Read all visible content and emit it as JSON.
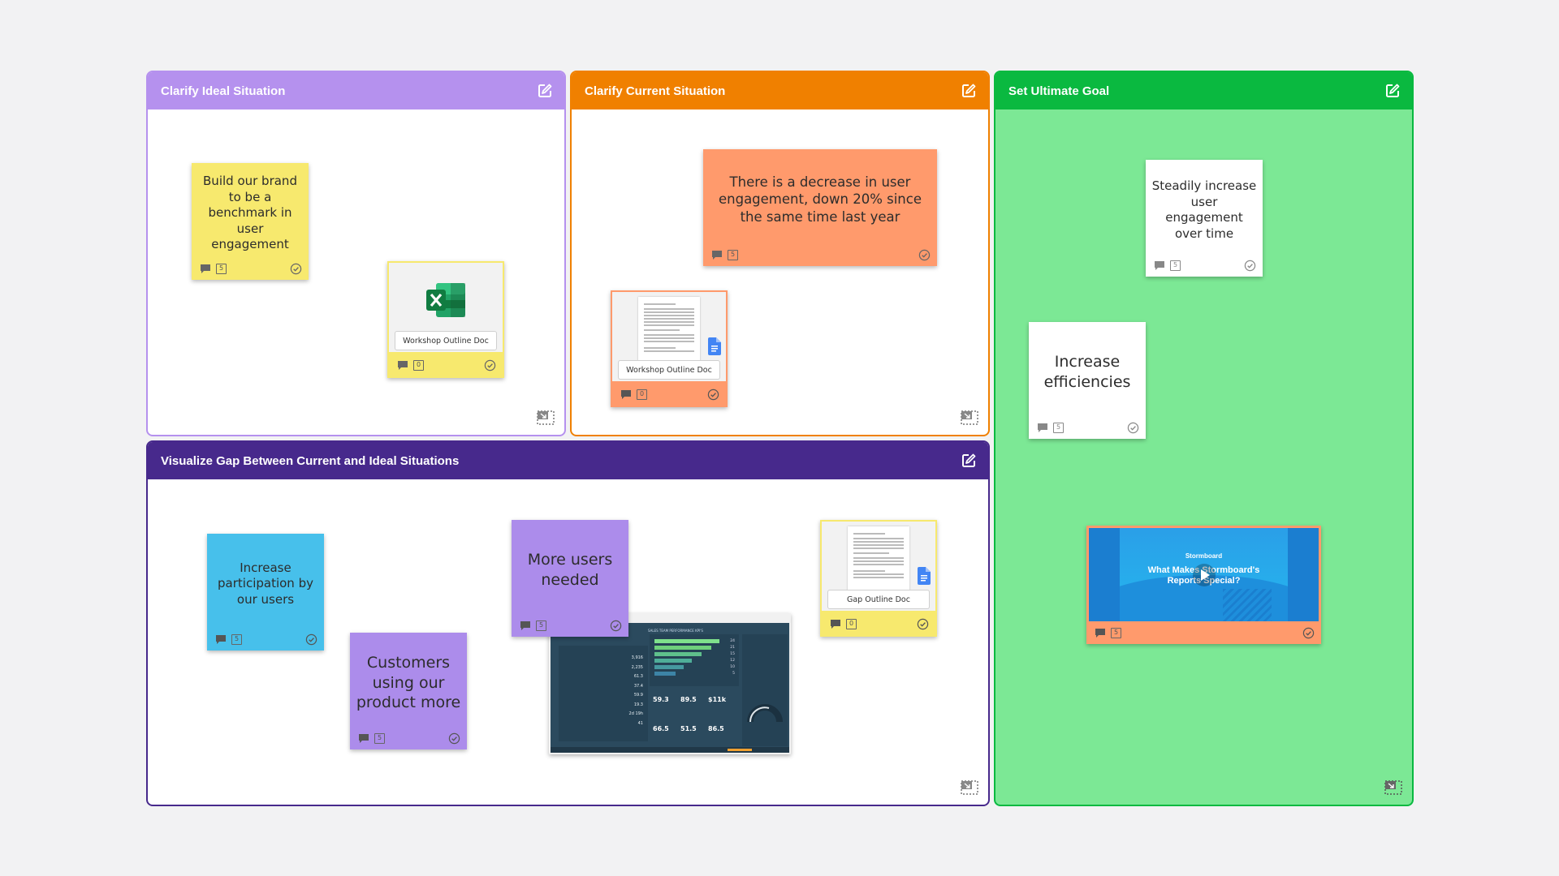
{
  "colors": {
    "ideal": "#b591ee",
    "current": "#f08000",
    "goal": "#0ab940",
    "goal_fill": "#7ce895",
    "gap": "#47298c",
    "note_yellow": "#f7e96e",
    "note_orange": "#ff9a6c",
    "note_blue": "#47c0eb",
    "note_purple": "#ac8ceb",
    "note_white": "#ffffff"
  },
  "sections": {
    "ideal": {
      "title": "Clarify Ideal Situation"
    },
    "current": {
      "title": "Clarify Current Situation"
    },
    "goal": {
      "title": "Set Ultimate Goal"
    },
    "gap": {
      "title": "Visualize Gap Between Current and Ideal Situations"
    }
  },
  "notes": {
    "brand": {
      "text": "Build our brand to be a benchmark in user engagement",
      "votes": "5"
    },
    "decrease": {
      "text": "There is a decrease in user engagement, down 20% since the same time last year",
      "votes": "5"
    },
    "steady": {
      "text": "Steadily increase user engagement over time",
      "votes": "5"
    },
    "efficiencies": {
      "text": "Increase efficiencies",
      "votes": "5"
    },
    "participation": {
      "text": "Increase participation by our users",
      "votes": "5"
    },
    "customers": {
      "text": "Customers using our product more",
      "votes": "5"
    },
    "more_users": {
      "text": "More users needed",
      "votes": "5"
    }
  },
  "docs": {
    "workshop_excel": {
      "label": "Workshop Outline Doc",
      "icon": "excel-icon",
      "votes": "0"
    },
    "workshop_gdoc": {
      "label": "Workshop Outline Doc",
      "icon": "google-docs-icon",
      "votes": "0"
    },
    "gap_gdoc": {
      "label": "Gap Outline Doc",
      "icon": "google-docs-icon",
      "votes": "0"
    }
  },
  "video": {
    "brand": "Stormboard",
    "title": "What Makes Stormboard's Reports Special?",
    "votes": "5"
  },
  "dashboard": {
    "title": "SALES TEAM PERFORMANCE KPI'S",
    "metrics": [
      "59.3",
      "89.5",
      "$11k",
      "66.5",
      "51.5",
      "86.5"
    ],
    "table_values": [
      "3,916",
      "2,235",
      "61.3",
      "37.4",
      "59.9",
      "19.3",
      "2d 19h",
      "41"
    ],
    "funnel_values": [
      "24",
      "21",
      "15",
      "12",
      "10",
      "5"
    ]
  }
}
